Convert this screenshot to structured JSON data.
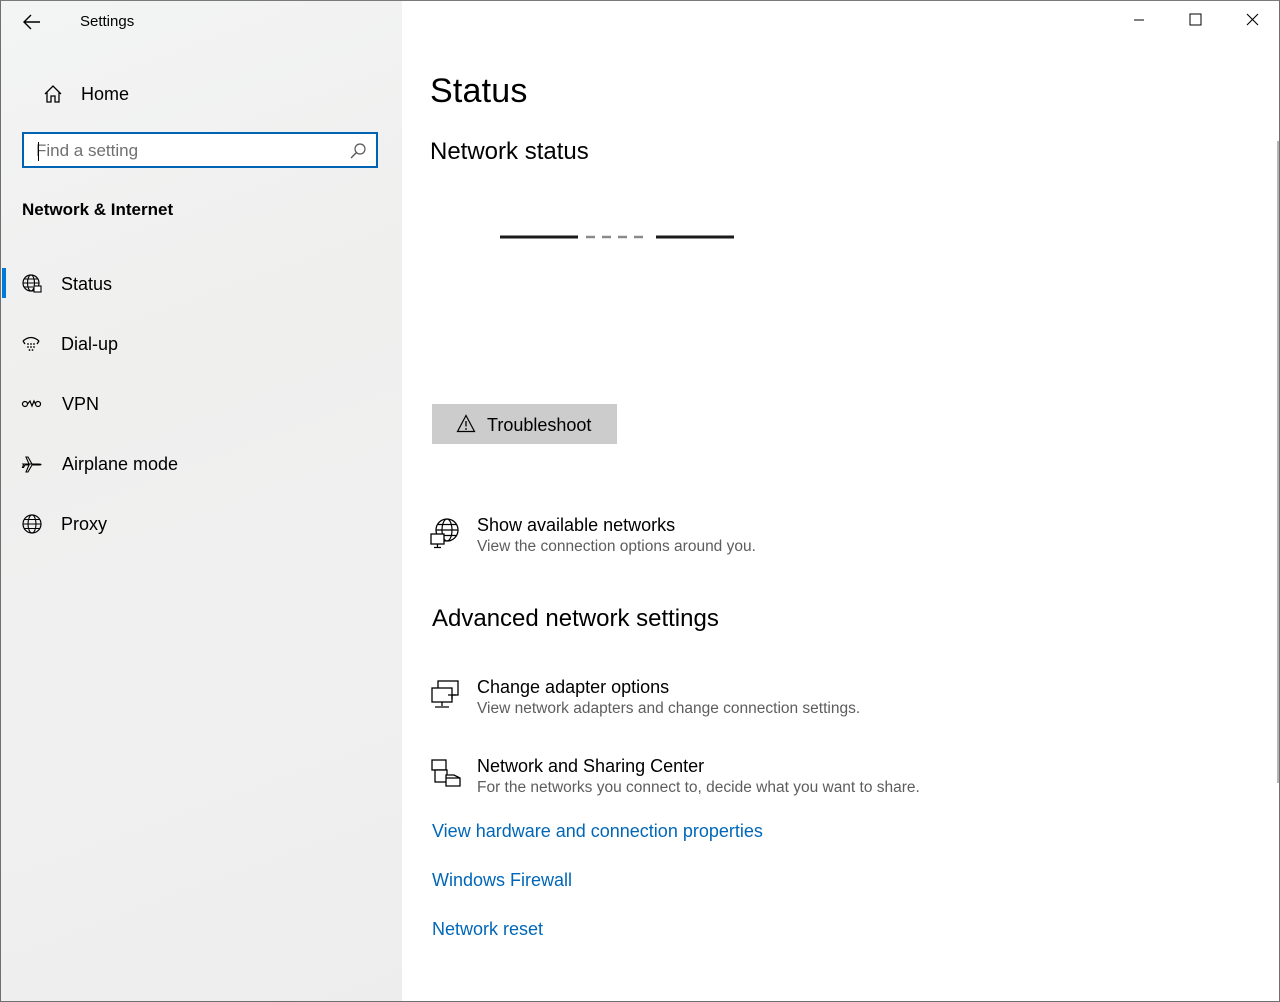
{
  "window": {
    "title": "Settings"
  },
  "sidebar": {
    "home_label": "Home",
    "search_placeholder": "Find a setting",
    "section_title": "Network & Internet",
    "items": [
      {
        "label": "Status",
        "icon": "globe-status-icon",
        "selected": true
      },
      {
        "label": "Dial-up",
        "icon": "dialup-phone-icon",
        "selected": false
      },
      {
        "label": "VPN",
        "icon": "vpn-icon",
        "selected": false
      },
      {
        "label": "Airplane mode",
        "icon": "airplane-icon",
        "selected": false
      },
      {
        "label": "Proxy",
        "icon": "globe-icon",
        "selected": false
      }
    ]
  },
  "main": {
    "page_title": "Status",
    "network_status_heading": "Network status",
    "troubleshoot_label": "Troubleshoot",
    "show_networks": {
      "title": "Show available networks",
      "subtitle": "View the connection options around you."
    },
    "advanced_heading": "Advanced network settings",
    "adapter_options": {
      "title": "Change adapter options",
      "subtitle": "View network adapters and change connection settings."
    },
    "sharing_center": {
      "title": "Network and Sharing Center",
      "subtitle": "For the networks you connect to, decide what you want to share."
    },
    "links": [
      "View hardware and connection properties",
      "Windows Firewall",
      "Network reset"
    ]
  },
  "colors": {
    "accent": "#0078d7",
    "link": "#0067b8",
    "search_border": "#0063b1",
    "button_bg": "#cccccc"
  }
}
